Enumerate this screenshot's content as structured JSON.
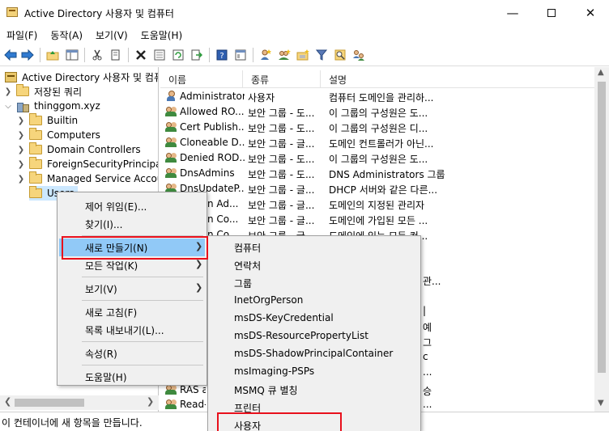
{
  "window": {
    "title": "Active Directory 사용자 및 컴퓨터",
    "min_glyph": "—",
    "close_glyph": "✕"
  },
  "menubar": [
    "파일(F)",
    "동작(A)",
    "보기(V)",
    "도움말(H)"
  ],
  "toolbar": {
    "icons": [
      "back-icon",
      "forward-icon",
      "up-folder-icon",
      "show-hide-tree-icon",
      "cut-icon",
      "copy-icon",
      "delete-icon",
      "properties-icon",
      "refresh-icon",
      "export-icon",
      "help-icon",
      "console-view-icon",
      "new-user-icon",
      "new-group-icon",
      "new-ou-icon",
      "filter-icon",
      "find-icon",
      "add-to-group-icon"
    ]
  },
  "tree": {
    "root": "Active Directory 사용자 및 컴퓨터",
    "saved_queries": "저장된 쿼리",
    "domain": "thinggom.xyz",
    "children": [
      "Builtin",
      "Computers",
      "Domain Controllers",
      "ForeignSecurityPrincipal",
      "Managed Service Accou",
      "Users"
    ]
  },
  "list": {
    "columns": [
      "이름",
      "종류",
      "설명"
    ],
    "rows": [
      {
        "name": "Administrator",
        "type": "사용자",
        "desc": "컴퓨터 도메인을 관리하...",
        "icon": "user-icon"
      },
      {
        "name": "Allowed RO...",
        "type": "보안 그룹 - 도...",
        "desc": "이 그룹의 구성원은 도...",
        "icon": "group-icon"
      },
      {
        "name": "Cert Publish...",
        "type": "보안 그룹 - 도...",
        "desc": "이 그룹의 구성원은 디...",
        "icon": "group-icon"
      },
      {
        "name": "Cloneable D...",
        "type": "보안 그룹 - 글...",
        "desc": "도메인 컨트롤러가 아닌...",
        "icon": "group-icon"
      },
      {
        "name": "Denied ROD...",
        "type": "보안 그룹 - 도...",
        "desc": "이 그룹의 구성원은 도...",
        "icon": "group-icon"
      },
      {
        "name": "DnsAdmins",
        "type": "보안 그룹 - 도...",
        "desc": "DNS Administrators 그룹",
        "icon": "group-icon"
      },
      {
        "name": "DnsUpdateP...",
        "type": "보안 그룹 - 글...",
        "desc": "DHCP 서버와 같은 다른...",
        "icon": "group-icon"
      },
      {
        "name": "n Ad...",
        "type": "보안 그룹 - 글...",
        "desc": "도메인의 지정된 관리자",
        "icon": "none"
      },
      {
        "name": "n Co...",
        "type": "보안 그룹 - 글...",
        "desc": "도메인에 가입된 모든 ...",
        "icon": "none"
      },
      {
        "name": "n Co...",
        "type": "보안 그룹 - 글...",
        "desc": "도메인에 있는 모든 컨...",
        "icon": "none"
      }
    ],
    "partial_desc": [
      "관...",
      "|",
      "예",
      "그",
      "с",
      "..."
    ],
    "bottom_rows": [
      {
        "name": "RAS a",
        "desc": "승"
      },
      {
        "name": "Read-",
        "desc": "..."
      }
    ]
  },
  "context_menu": {
    "items": [
      "제어 위임(E)...",
      "찾기(I)...",
      "새로 만들기(N)",
      "모든 작업(K)",
      "보기(V)",
      "새로 고침(F)",
      "목록 내보내기(L)...",
      "속성(R)",
      "도움말(H)"
    ]
  },
  "submenu": {
    "items": [
      "컴퓨터",
      "연락처",
      "그룹",
      "InetOrgPerson",
      "msDS-KeyCredential",
      "msDS-ResourcePropertyList",
      "msDS-ShadowPrincipalContainer",
      "msImaging-PSPs",
      "MSMQ 큐 별칭",
      "프린터",
      "사용자"
    ]
  },
  "status": {
    "text": "이 컨테이너에 새 항목을 만듭니다."
  },
  "colors": {
    "highlight_box": "#e8101c",
    "menu_selected": "#91c9f7",
    "tree_selected": "#cce8ff"
  }
}
